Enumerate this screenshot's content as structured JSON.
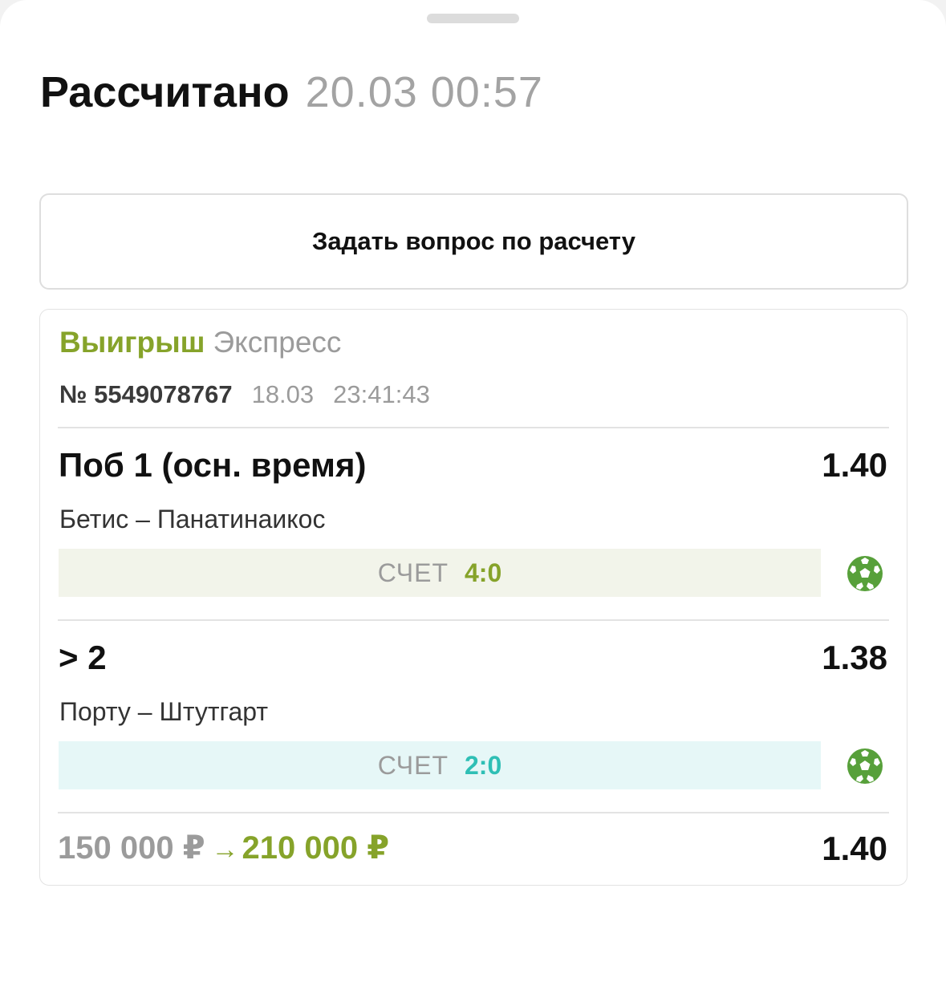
{
  "header": {
    "title": "Рассчитано",
    "datetime": "20.03 00:57"
  },
  "ask_button": {
    "label": "Задать вопрос по расчету"
  },
  "bet": {
    "status": "Выигрыш",
    "type": "Экспресс",
    "number": "№ 5549078767",
    "date": "18.03",
    "time": "23:41:43",
    "events": [
      {
        "market": "Поб 1 (осн. время)",
        "odds": "1.40",
        "teams": "Бетис – Панатинаикос",
        "score_label": "СЧЕТ",
        "score": "4:0",
        "score_color": "#86a32a",
        "score_bg": "#f2f4ea",
        "sport_icon": "soccer-ball-icon"
      },
      {
        "market": "> 2",
        "odds": "1.38",
        "teams": "Порту – Штутгарт",
        "score_label": "СЧЕТ",
        "score": "2:0",
        "score_color": "#2fbfb5",
        "score_bg": "#e6f7f7",
        "sport_icon": "soccer-ball-icon"
      }
    ],
    "stake": "150 000 ₽",
    "arrow": "→",
    "payout": "210 000 ₽",
    "total_odds": "1.40"
  },
  "colors": {
    "win_green": "#86a32a",
    "muted_gray": "#9b9b9b",
    "ball_green": "#57a03a"
  }
}
